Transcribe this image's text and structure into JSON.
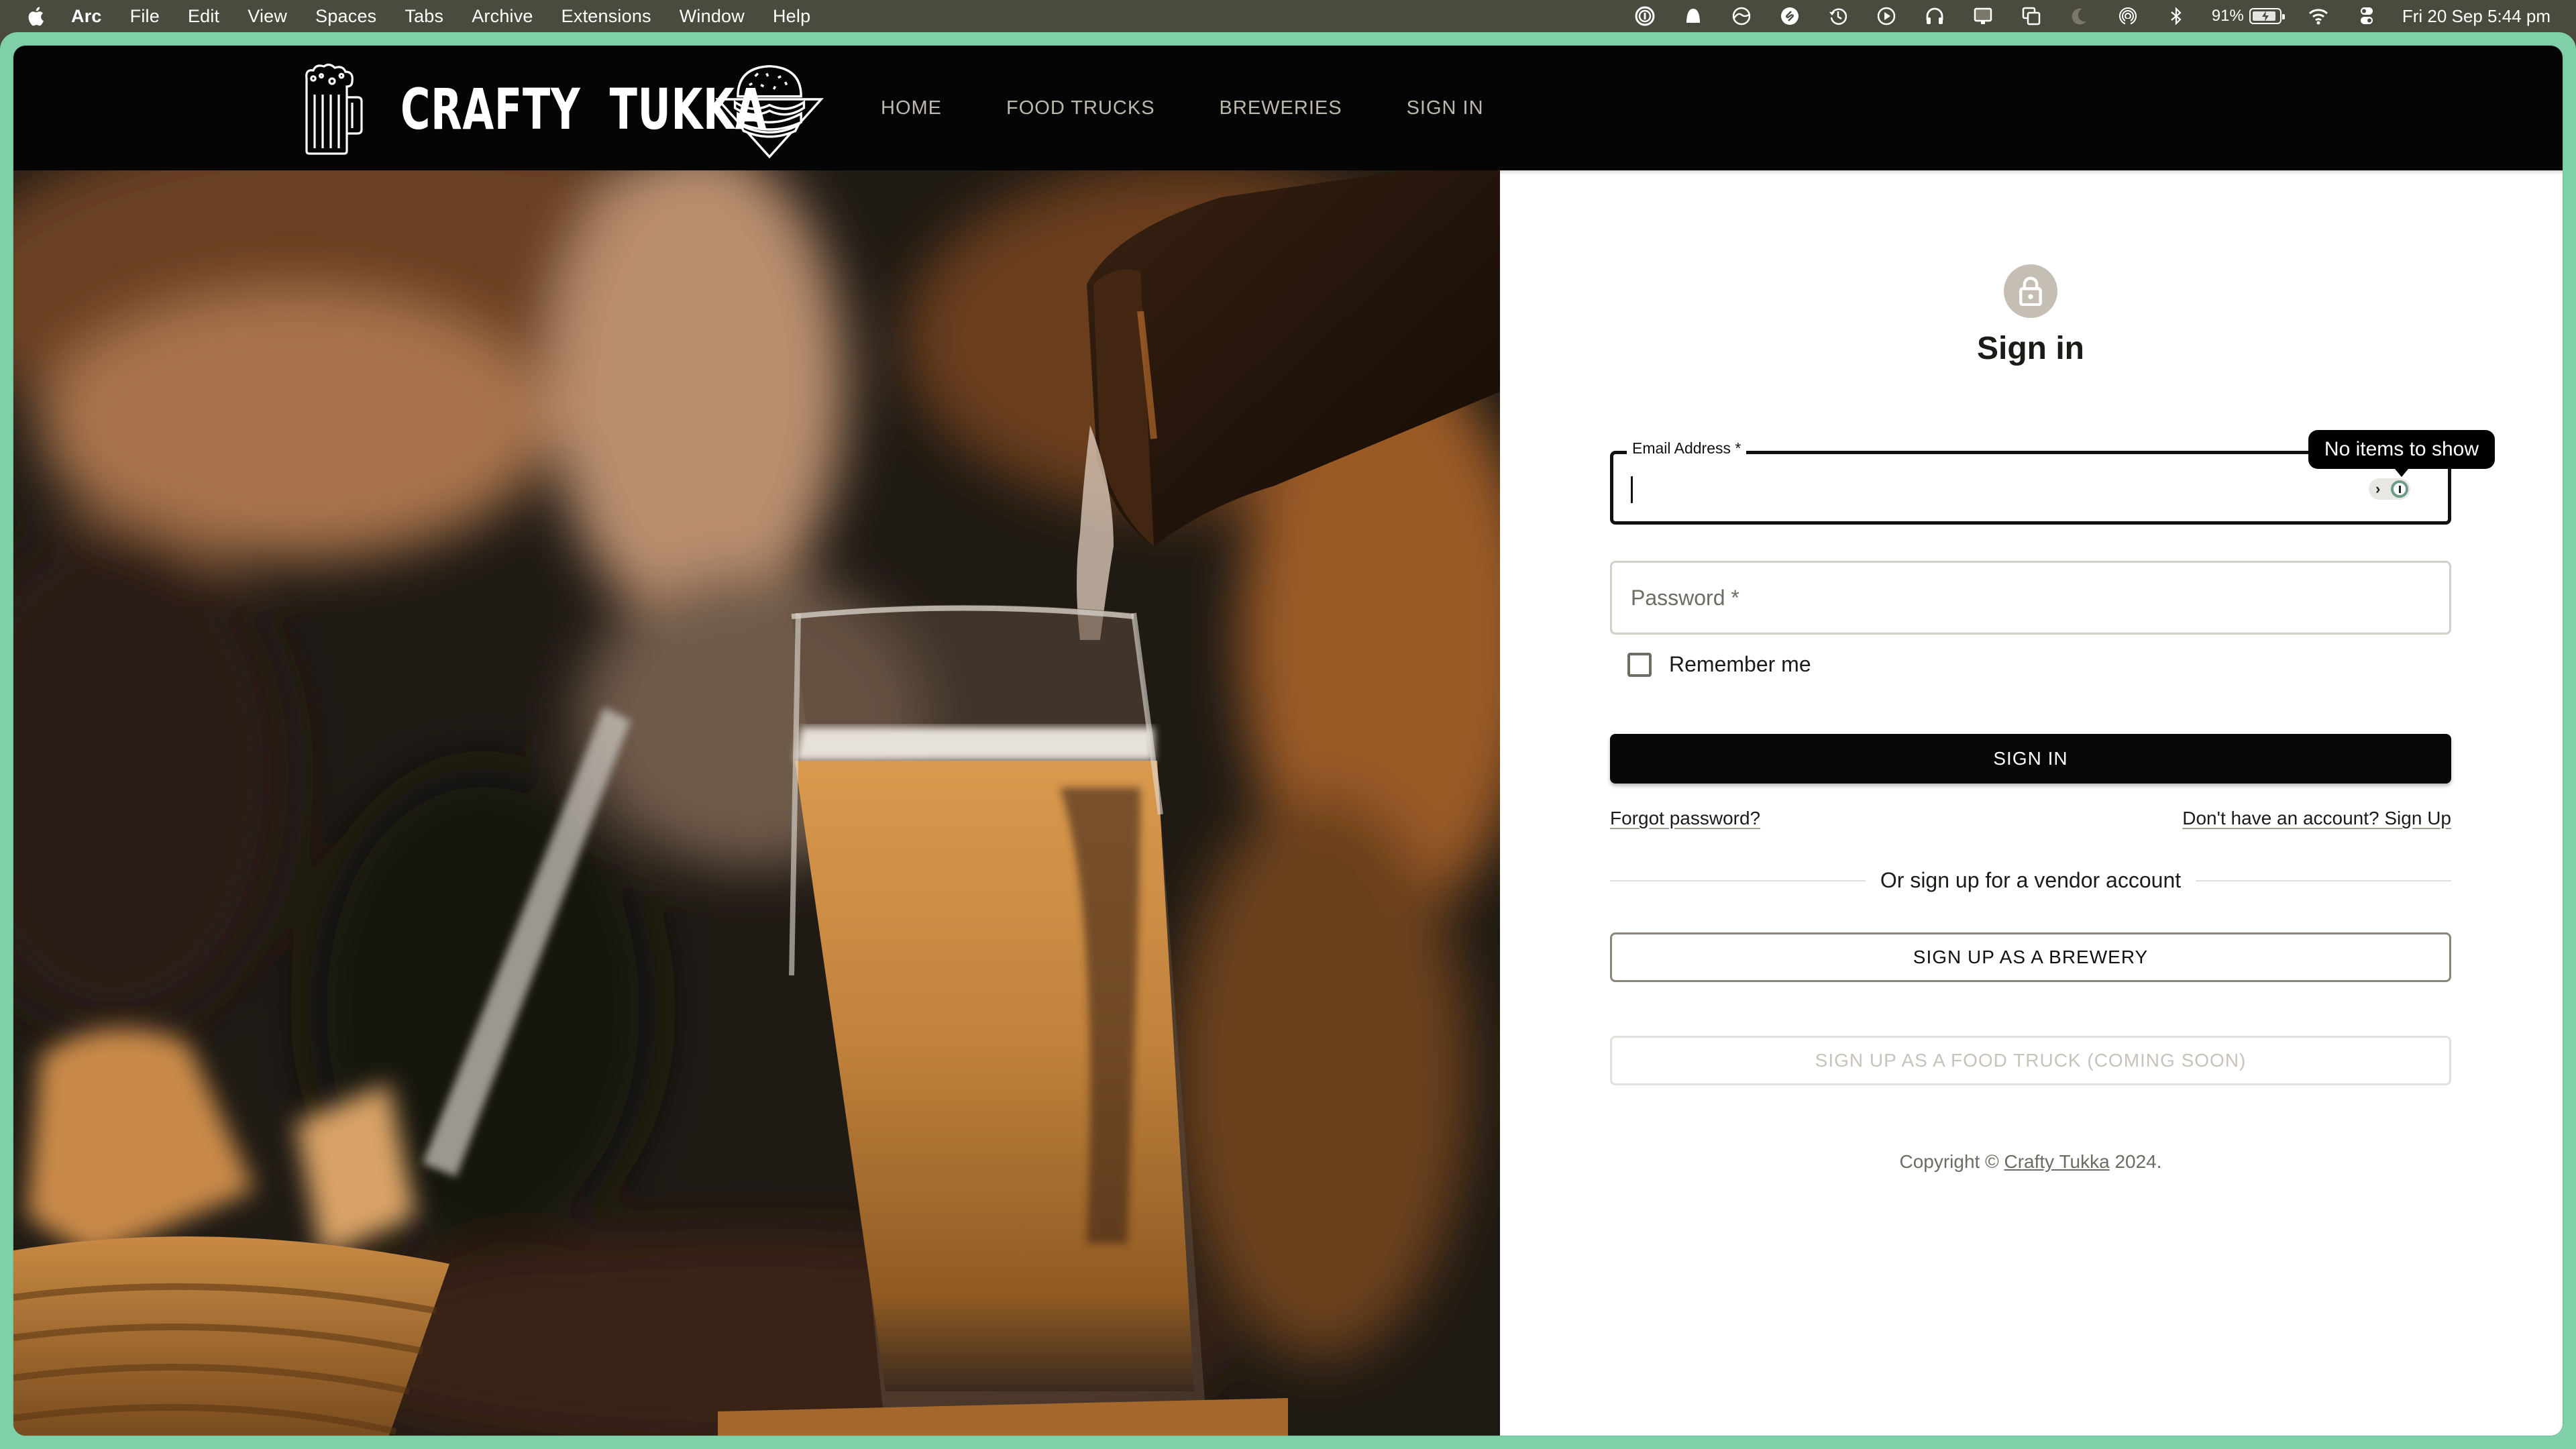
{
  "menubar": {
    "app_name": "Arc",
    "menus": [
      "File",
      "Edit",
      "View",
      "Spaces",
      "Tabs",
      "Archive",
      "Extensions",
      "Window",
      "Help"
    ],
    "status_icons": [
      "1password-icon",
      "notification-bell-icon",
      "arc-icon",
      "shazam-icon",
      "time-machine-icon",
      "play-icon",
      "headphones-icon",
      "display-icon",
      "screen-mirroring-icon",
      "focus-moon-icon",
      "airdrop-icon",
      "bluetooth-icon"
    ],
    "battery_percent": "91%",
    "battery_level": 0.91,
    "datetime": "Fri 20 Sep  5:44 pm"
  },
  "site": {
    "brand": "CRAFTY TUKKA",
    "brand_part1": "CRAFTY",
    "brand_part2": "TUKKA",
    "nav": [
      {
        "label": "HOME"
      },
      {
        "label": "FOOD TRUCKS"
      },
      {
        "label": "BREWERIES"
      },
      {
        "label": "SIGN IN"
      }
    ]
  },
  "hero": {
    "description": "Beer being poured from a bottle into a glass, basket on the left"
  },
  "signin": {
    "title": "Sign in",
    "email_label": "Email Address *",
    "email_value": "",
    "tooltip": "No items to show",
    "password_placeholder": "Password *",
    "remember_label": "Remember me",
    "remember_checked": false,
    "submit_label": "SIGN IN",
    "forgot_link": "Forgot password?",
    "signup_link": "Don't have an account? Sign Up",
    "divider_text": "Or sign up for a vendor account",
    "brewery_button": "SIGN UP AS A BREWERY",
    "foodtruck_button": "SIGN UP AS A FOOD TRUCK (COMING SOON)",
    "copyright_prefix": "Copyright © ",
    "copyright_link": "Crafty Tukka",
    "copyright_suffix": " 2024."
  },
  "colors": {
    "frame_accent": "#7fd0a8",
    "header_bg": "#050505",
    "nav_text": "#bdb8ad",
    "avatar_bg": "#c5beb4",
    "primary_button": "#070707"
  }
}
